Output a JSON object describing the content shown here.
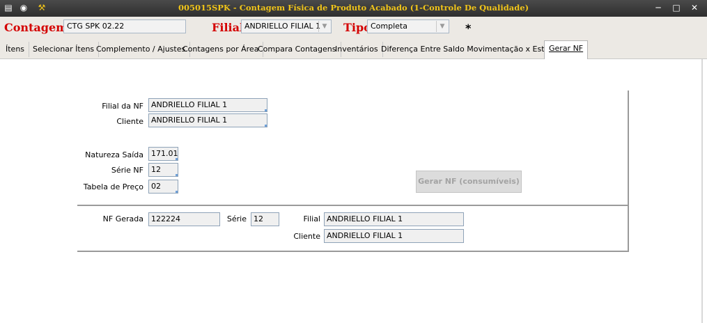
{
  "window": {
    "title": "005015SPK - Contagem Física de Produto Acabado (1-Controle De Qualidade)"
  },
  "header": {
    "contagem_label": "Contagem",
    "contagem_value": "CTG SPK 02.22",
    "filial_label": "Filial",
    "filial_value": "ANDRIELLO FILIAL 1",
    "tipo_label": "Tipo",
    "tipo_value": "Completa",
    "required_marker": "*"
  },
  "tabs": [
    {
      "label": "Ítens"
    },
    {
      "label": "Selecionar Ítens"
    },
    {
      "label": "Complemento / Ajustes"
    },
    {
      "label": "Contagens por Área"
    },
    {
      "label": "Compara Contagens"
    },
    {
      "label": "Inventários"
    },
    {
      "label": "Diferença Entre Saldo Movimentação x Estoque"
    },
    {
      "label": "Gerar NF",
      "active": true
    }
  ],
  "form": {
    "filial_nf_label": "Filial da NF",
    "filial_nf_value": "ANDRIELLO FILIAL 1",
    "cliente_label": "Cliente",
    "cliente_value": "ANDRIELLO FILIAL 1",
    "natureza_label": "Natureza Saída",
    "natureza_value": "171.01",
    "serie_label": "Série NF",
    "serie_value": "12",
    "tabela_label": "Tabela de Preço",
    "tabela_value": "02",
    "gerar_button": "Gerar NF (consumíveis)"
  },
  "result": {
    "nf_gerada_label": "NF Gerada",
    "nf_gerada_value": "122224",
    "serie_label": "Série",
    "serie_value": "12",
    "filial_label": "Filial",
    "filial_value": "ANDRIELLO FILIAL 1",
    "cliente_label": "Cliente",
    "cliente_value": "ANDRIELLO FILIAL 1"
  },
  "colors": {
    "title_text": "#f0c419",
    "label_red": "#d40000",
    "titlebar_bg": "#3a3a3a"
  }
}
